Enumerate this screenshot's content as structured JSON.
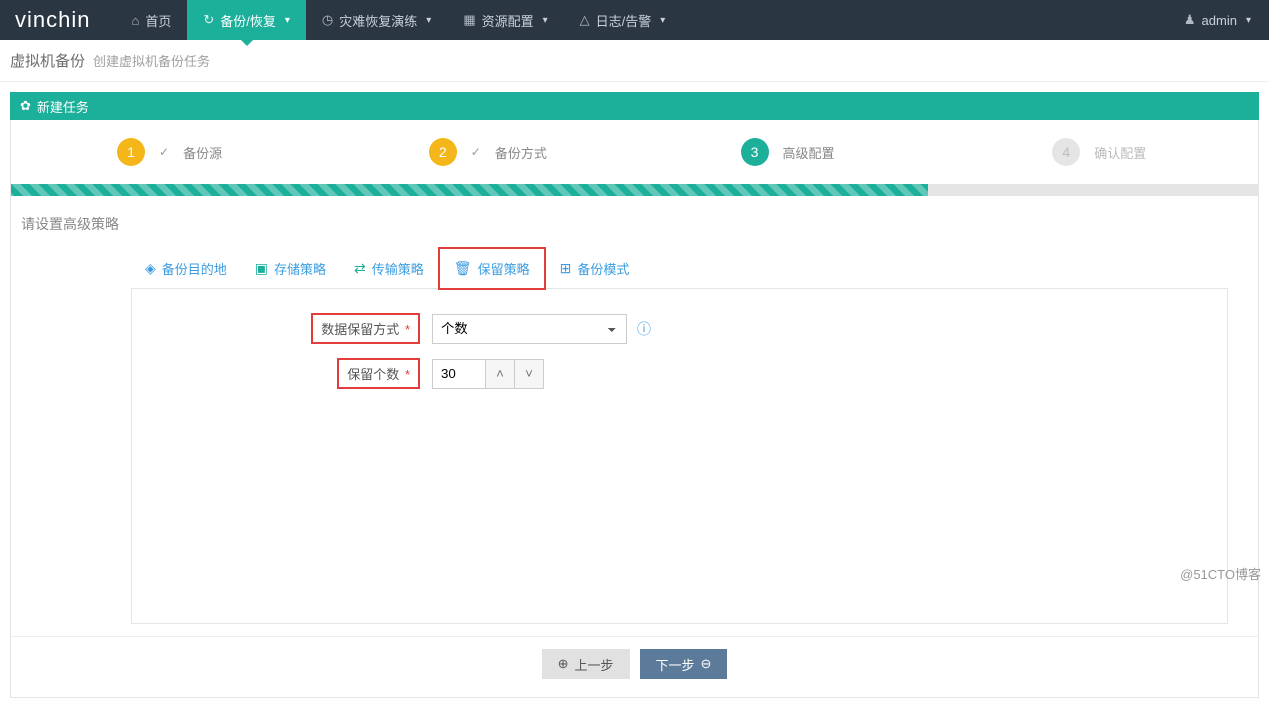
{
  "brand": "vinchin",
  "nav": {
    "home": "首页",
    "backup": "备份/恢复",
    "dr": "灾难恢复演练",
    "resource": "资源配置",
    "log": "日志/告警"
  },
  "user": {
    "name": "admin"
  },
  "breadcrumb": {
    "main": "虚拟机备份",
    "sub": "创建虚拟机备份任务"
  },
  "panel": {
    "title": "新建任务",
    "gear": "✿"
  },
  "steps": [
    {
      "num": "1",
      "label": "备份源"
    },
    {
      "num": "2",
      "label": "备份方式"
    },
    {
      "num": "3",
      "label": "高级配置"
    },
    {
      "num": "4",
      "label": "确认配置"
    }
  ],
  "section_title": "请设置高级策略",
  "tabs": {
    "dest": "备份目的地",
    "storage": "存储策略",
    "transfer": "传输策略",
    "retain": "保留策略",
    "mode": "备份模式"
  },
  "form": {
    "retain_mode_label": "数据保留方式",
    "retain_mode_value": "个数",
    "retain_count_label": "保留个数",
    "retain_count_value": "30"
  },
  "buttons": {
    "prev": "上一步",
    "next": "下一步"
  },
  "watermark": "@51CTO博客"
}
